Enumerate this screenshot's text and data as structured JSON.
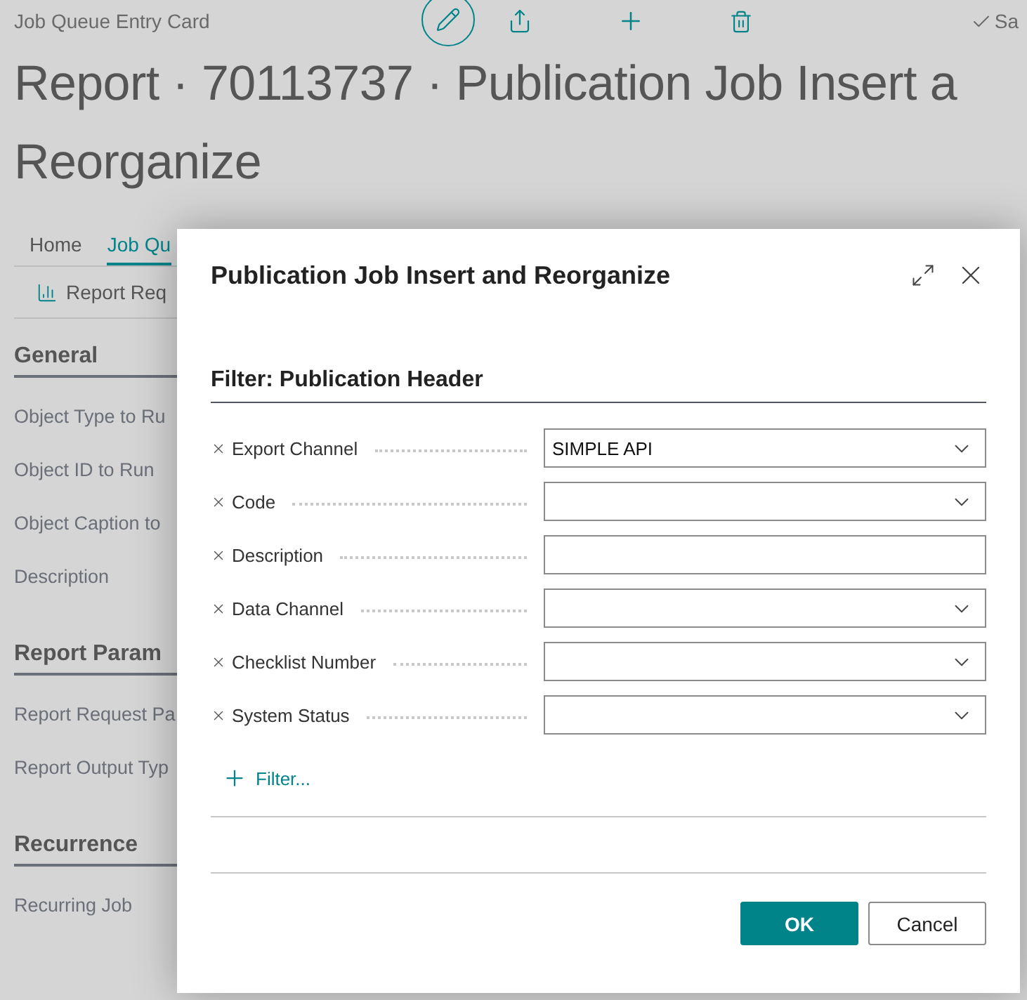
{
  "page": {
    "breadcrumb": "Job Queue Entry Card",
    "save": "Sa",
    "title_lines": [
      "Report · 70113737 · Publication Job Insert a",
      "Reorganize"
    ],
    "tabs": [
      {
        "label": "Home",
        "selected": false
      },
      {
        "label": "Job Qu",
        "selected": true
      }
    ],
    "action": "Report Req",
    "sections": [
      {
        "title": "General",
        "fields": [
          "Object Type to Ru",
          "Object ID to Run",
          "Object Caption to",
          "Description"
        ]
      },
      {
        "title": "Report Param",
        "fields": [
          "Report Request Pa",
          "Report Output Typ"
        ]
      },
      {
        "title": "Recurrence",
        "fields": [
          "Recurring Job"
        ]
      }
    ]
  },
  "dialog": {
    "title": "Publication Job Insert and Reorganize",
    "filter_heading": "Filter: Publication Header",
    "filters": [
      {
        "label": "Export Channel",
        "kind": "lookup",
        "value": "SIMPLE API"
      },
      {
        "label": "Code",
        "kind": "lookup"
      },
      {
        "label": "Description",
        "kind": "text"
      },
      {
        "label": "Data Channel",
        "kind": "lookup"
      },
      {
        "label": "Checklist Number",
        "kind": "lookup"
      },
      {
        "label": "System Status",
        "kind": "lookup"
      }
    ],
    "add_filter": "Filter...",
    "buttons": [
      {
        "label": "OK",
        "kind": "primary"
      },
      {
        "label": "Cancel",
        "kind": "secondary"
      }
    ]
  }
}
